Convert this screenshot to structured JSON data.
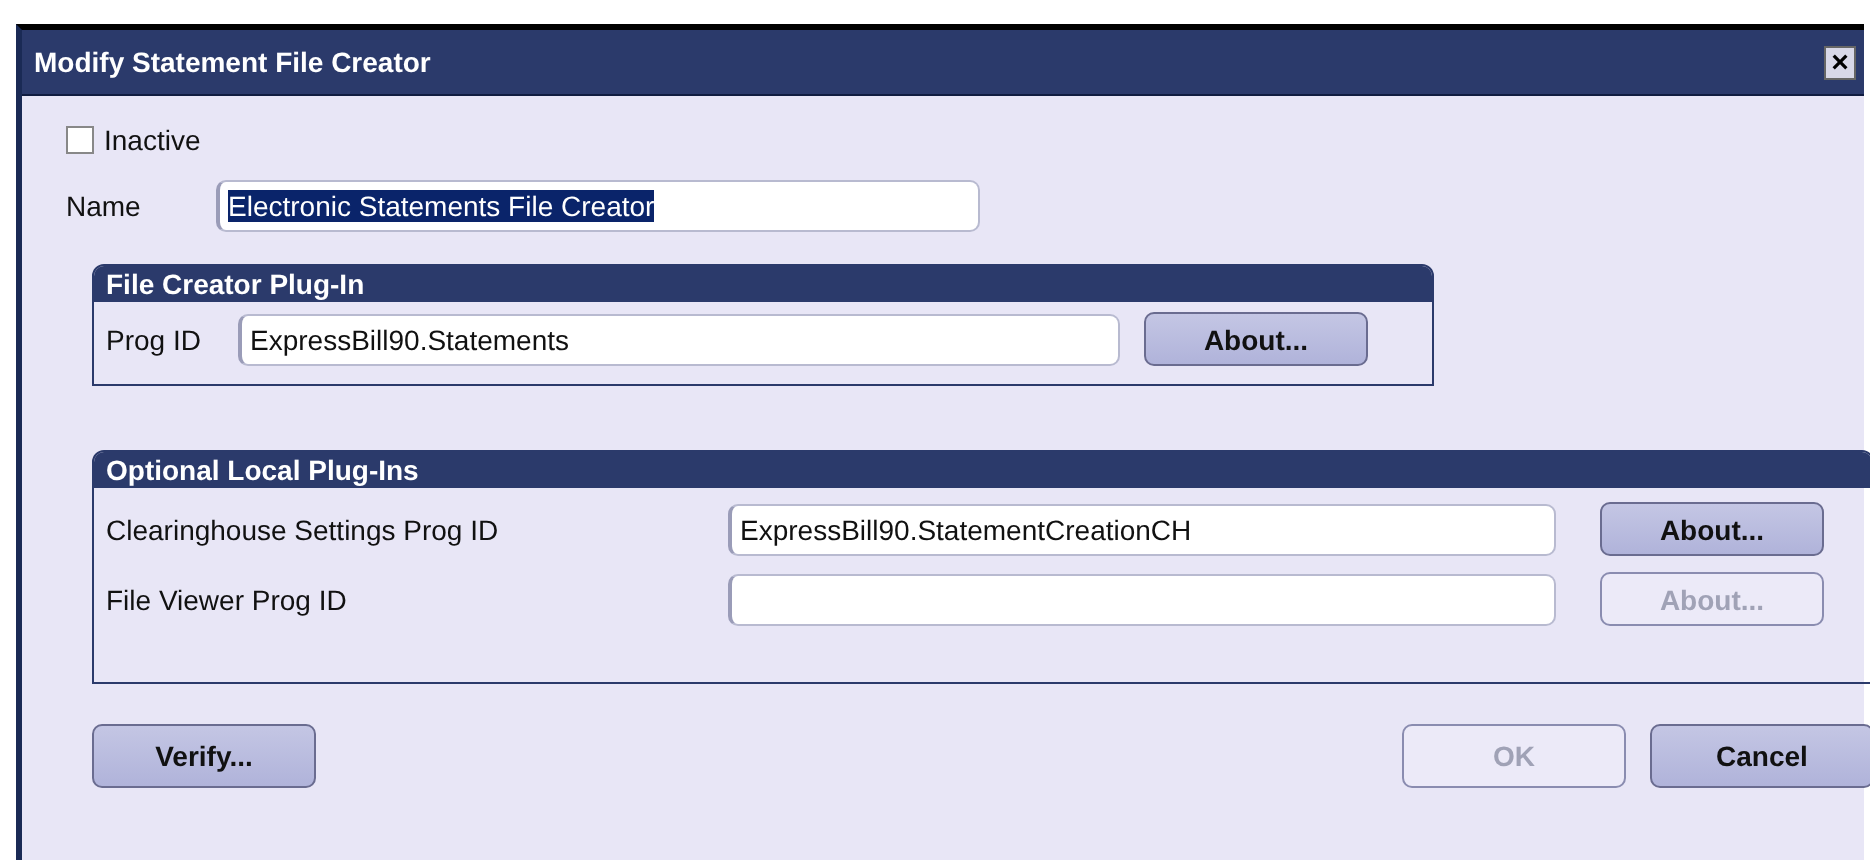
{
  "window": {
    "title": "Modify Statement File Creator",
    "close": "×"
  },
  "inactive": {
    "label": "Inactive",
    "checked": false
  },
  "name": {
    "label": "Name",
    "value": "Electronic Statements File Creator",
    "highlighted": true
  },
  "file_creator_plugin": {
    "title": "File Creator Plug-In",
    "label": "Prog ID",
    "value": "ExpressBill90.Statements",
    "button": {
      "label": "About...",
      "disabled": false
    }
  },
  "optional_local_plugins": {
    "title": "Optional Local Plug-Ins",
    "rows": [
      {
        "label": "Clearinghouse Settings Prog ID",
        "value": "ExpressBill90.StatementCreationCH",
        "button": {
          "label": "About...",
          "disabled": false
        }
      },
      {
        "label": "File Viewer Prog ID",
        "value": "",
        "button": {
          "label": "About...",
          "disabled": true
        }
      }
    ]
  },
  "buttons": [
    {
      "label": "Verify...",
      "disabled": false
    },
    {
      "label": "OK",
      "disabled": true
    },
    {
      "label": "Cancel",
      "disabled": false
    }
  ]
}
